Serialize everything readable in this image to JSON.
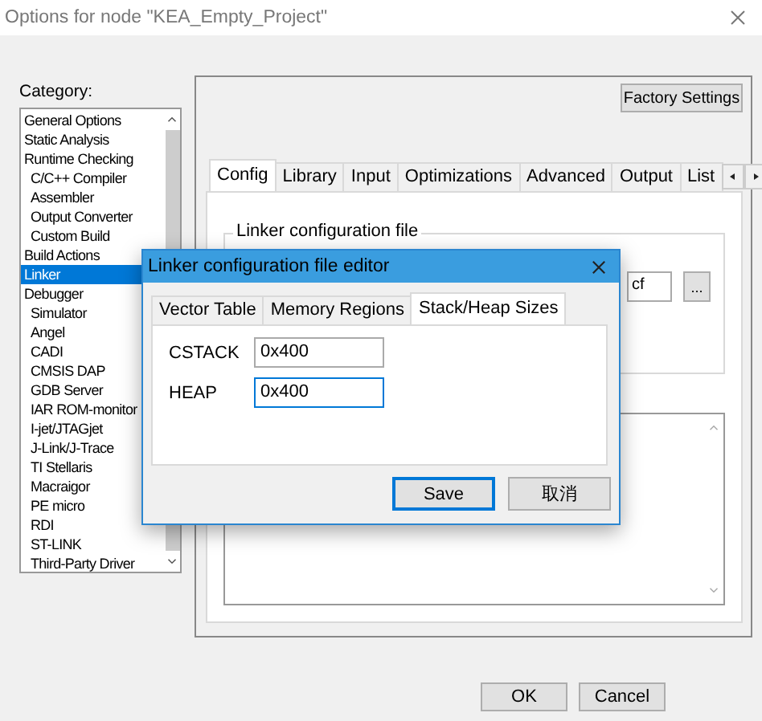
{
  "window": {
    "title": "Options for node \"KEA_Empty_Project\""
  },
  "category": {
    "label": "Category:",
    "items": [
      {
        "label": "General Options",
        "selected": false
      },
      {
        "label": "Static Analysis",
        "selected": false
      },
      {
        "label": "Runtime Checking",
        "selected": false,
        "children": [
          {
            "label": "C/C++ Compiler",
            "selected": false
          },
          {
            "label": "Assembler",
            "selected": false
          },
          {
            "label": "Output Converter",
            "selected": false
          },
          {
            "label": "Custom Build",
            "selected": false
          }
        ]
      },
      {
        "label": "Build Actions",
        "selected": false
      },
      {
        "label": "Linker",
        "selected": true
      },
      {
        "label": "Debugger",
        "selected": false,
        "children": [
          {
            "label": "Simulator",
            "selected": false
          },
          {
            "label": "Angel",
            "selected": false
          },
          {
            "label": "CADI",
            "selected": false
          },
          {
            "label": "CMSIS DAP",
            "selected": false
          },
          {
            "label": "GDB Server",
            "selected": false
          },
          {
            "label": "IAR ROM-monitor",
            "selected": false
          },
          {
            "label": "I-jet/JTAGjet",
            "selected": false
          },
          {
            "label": "J-Link/J-Trace",
            "selected": false
          },
          {
            "label": "TI Stellaris",
            "selected": false
          },
          {
            "label": "Macraigor",
            "selected": false
          },
          {
            "label": "PE micro",
            "selected": false
          },
          {
            "label": "RDI",
            "selected": false
          },
          {
            "label": "ST-LINK",
            "selected": false
          },
          {
            "label": "Third-Party Driver",
            "selected": false
          }
        ]
      }
    ]
  },
  "factory_settings": "Factory Settings",
  "tabs": [
    {
      "label": "Config",
      "selected": true
    },
    {
      "label": "Library",
      "selected": false
    },
    {
      "label": "Input",
      "selected": false
    },
    {
      "label": "Optimizations",
      "selected": false
    },
    {
      "label": "Advanced",
      "selected": false
    },
    {
      "label": "Output",
      "selected": false
    },
    {
      "label": "List",
      "selected": false
    }
  ],
  "linker_group": {
    "title": "Linker configuration file",
    "file_value": "cf",
    "browse": "..."
  },
  "dialog": {
    "title": "Linker configuration file editor",
    "tabs": [
      {
        "label": "Vector Table",
        "selected": false
      },
      {
        "label": "Memory Regions",
        "selected": false
      },
      {
        "label": "Stack/Heap Sizes",
        "selected": true
      }
    ],
    "fields": [
      {
        "label": "CSTACK",
        "value": "0x400",
        "focused": false
      },
      {
        "label": "HEAP",
        "value": "0x400",
        "focused": true
      }
    ],
    "buttons": [
      {
        "label": "Save",
        "default": true
      },
      {
        "label": "取消",
        "default": false
      }
    ]
  },
  "buttons": [
    "OK",
    "Cancel"
  ]
}
